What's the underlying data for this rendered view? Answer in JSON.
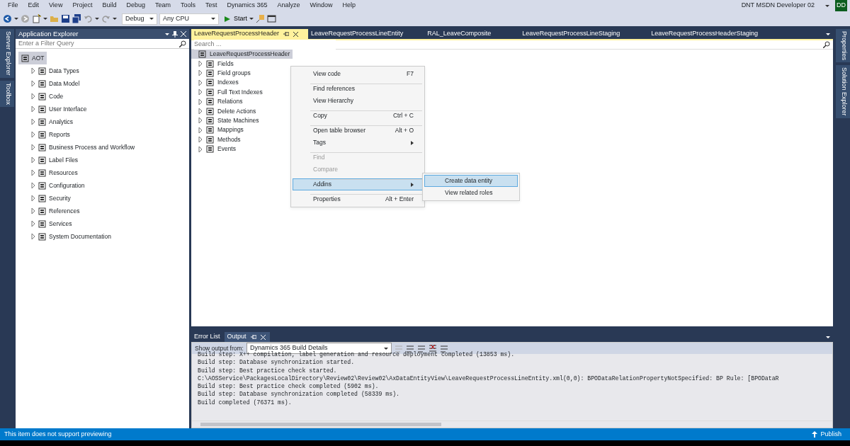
{
  "menu_bar": [
    "File",
    "Edit",
    "View",
    "Project",
    "Build",
    "Debug",
    "Team",
    "Tools",
    "Test",
    "Dynamics 365",
    "Analyze",
    "Window",
    "Help"
  ],
  "account": {
    "name": "DNT MSDN Developer 02",
    "initials": "DD"
  },
  "toolbar": {
    "configuration": "Debug",
    "platform": "Any CPU",
    "start": "Start"
  },
  "left_strip": [
    "Server Explorer",
    "Toolbox"
  ],
  "right_strip": [
    "Properties",
    "Solution Explorer"
  ],
  "application_explorer": {
    "title": "Application Explorer",
    "filter_placeholder": "Enter a Filter Query",
    "root": {
      "label": "AOT",
      "selected": true,
      "children": [
        {
          "label": "Data Types",
          "selected": false
        },
        {
          "label": "Data Model",
          "selected": false
        },
        {
          "label": "Code",
          "selected": false
        },
        {
          "label": "User Interface",
          "selected": false
        },
        {
          "label": "Analytics",
          "selected": false
        },
        {
          "label": "Reports",
          "selected": false
        },
        {
          "label": "Business Process and Workflow",
          "selected": false
        },
        {
          "label": "Label Files",
          "selected": false
        },
        {
          "label": "Resources",
          "selected": false
        },
        {
          "label": "Configuration",
          "selected": false
        },
        {
          "label": "Security",
          "selected": false
        },
        {
          "label": "References",
          "selected": false
        },
        {
          "label": "Services",
          "selected": false
        },
        {
          "label": "System Documentation",
          "selected": false
        }
      ]
    }
  },
  "editor_tabs": [
    {
      "label": "LeaveRequestProcessHeader",
      "selected": true
    },
    {
      "label": "LeaveRequestProcessLineEntity",
      "selected": false
    },
    {
      "label": "RAL_LeaveComposite",
      "selected": false
    },
    {
      "label": "LeaveRequestProcessLineStaging",
      "selected": false
    },
    {
      "label": "LeaveRequestProcessHeaderStaging",
      "selected": false
    }
  ],
  "designer": {
    "search_placeholder": "Search ...",
    "root": {
      "label": "LeaveRequestProcessHeader",
      "selected": true,
      "children": [
        {
          "label": "Fields",
          "selected": false
        },
        {
          "label": "Field groups",
          "selected": false
        },
        {
          "label": "Indexes",
          "selected": false
        },
        {
          "label": "Full Text Indexes",
          "selected": false
        },
        {
          "label": "Relations",
          "selected": false
        },
        {
          "label": "Delete Actions",
          "selected": false
        },
        {
          "label": "State Machines",
          "selected": false
        },
        {
          "label": "Mappings",
          "selected": false
        },
        {
          "label": "Methods",
          "selected": false
        },
        {
          "label": "Events",
          "selected": false
        }
      ]
    }
  },
  "context_menu": [
    {
      "label": "View code",
      "shortcut": "F7",
      "group_start": false,
      "disabled": false,
      "submenu": false,
      "selected": false
    },
    {
      "label": "Find references",
      "group_start": true,
      "disabled": false,
      "submenu": false,
      "selected": false
    },
    {
      "label": "View Hierarchy",
      "group_start": false,
      "disabled": false,
      "submenu": false,
      "selected": false
    },
    {
      "label": "Copy",
      "shortcut": "Ctrl + C",
      "group_start": true,
      "disabled": false,
      "submenu": false,
      "selected": false
    },
    {
      "label": "Open table browser",
      "shortcut": "Alt + O",
      "group_start": true,
      "disabled": false,
      "submenu": false,
      "selected": false
    },
    {
      "label": "Tags",
      "group_start": false,
      "disabled": false,
      "submenu": true,
      "selected": false
    },
    {
      "label": "Find",
      "group_start": true,
      "disabled": true,
      "submenu": false,
      "selected": false
    },
    {
      "label": "Compare",
      "group_start": false,
      "disabled": true,
      "submenu": false,
      "selected": false
    },
    {
      "label": "Addins",
      "group_start": true,
      "disabled": false,
      "submenu": true,
      "selected": true
    },
    {
      "label": "Properties",
      "shortcut": "Alt + Enter",
      "group_start": true,
      "disabled": false,
      "submenu": false,
      "selected": false
    }
  ],
  "submenu": [
    {
      "label": "Create data entity",
      "selected": true
    },
    {
      "label": "View related roles",
      "selected": false
    }
  ],
  "output_panel": {
    "tabs": [
      {
        "label": "Error List",
        "selected": false
      },
      {
        "label": "Output",
        "selected": true
      }
    ],
    "show_output_from_label": "Show output from:",
    "source": "Dynamics 365 Build Details",
    "lines": [
      "Build step: X++ compilation, label generation and resource deployment completed (13853 ms).",
      "Build step: Database synchronization started.",
      "Build step: Best practice check started.",
      "C:\\AOSService\\PackagesLocalDirectory\\Review02\\Review02\\AxDataEntityView\\LeaveRequestProcessLineEntity.xml(0,0):  BPODataRelationPropertyNotSpecified: BP Rule: [BPODataR",
      "Build step: Best practice check completed (5902 ms).",
      "Build step: Database synchronization completed (58339 ms).",
      "Build completed (76371 ms)."
    ]
  },
  "status_bar": {
    "message": "This item does not support previewing",
    "publish": "Publish"
  }
}
